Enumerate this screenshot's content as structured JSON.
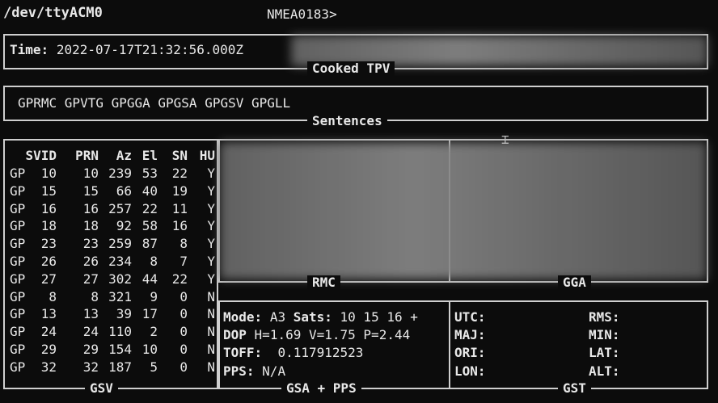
{
  "header": {
    "device": "/dev/ttyACM0",
    "mode": "NMEA0183>"
  },
  "tpv": {
    "time_label": "Time:",
    "time_value": "2022-07-17T21:32:56.000Z",
    "title": "Cooked TPV"
  },
  "sentences": {
    "list": "GPRMC GPVTG GPGGA GPGSA GPGSV GPGLL",
    "title": "Sentences"
  },
  "gsv": {
    "title": "GSV",
    "columns": [
      "SVID",
      "PRN",
      "Az",
      "El",
      "SN",
      "HU"
    ],
    "rows": [
      {
        "gnss": "GP",
        "svid": "10",
        "prn": "10",
        "az": "239",
        "el": "53",
        "sn": "22",
        "hu": "Y"
      },
      {
        "gnss": "GP",
        "svid": "15",
        "prn": "15",
        "az": "66",
        "el": "40",
        "sn": "19",
        "hu": "Y"
      },
      {
        "gnss": "GP",
        "svid": "16",
        "prn": "16",
        "az": "257",
        "el": "22",
        "sn": "11",
        "hu": "Y"
      },
      {
        "gnss": "GP",
        "svid": "18",
        "prn": "18",
        "az": "92",
        "el": "58",
        "sn": "16",
        "hu": "Y"
      },
      {
        "gnss": "GP",
        "svid": "23",
        "prn": "23",
        "az": "259",
        "el": "87",
        "sn": "8",
        "hu": "Y"
      },
      {
        "gnss": "GP",
        "svid": "26",
        "prn": "26",
        "az": "234",
        "el": "8",
        "sn": "7",
        "hu": "Y"
      },
      {
        "gnss": "GP",
        "svid": "27",
        "prn": "27",
        "az": "302",
        "el": "44",
        "sn": "22",
        "hu": "Y"
      },
      {
        "gnss": "GP",
        "svid": "8",
        "prn": "8",
        "az": "321",
        "el": "9",
        "sn": "0",
        "hu": "N"
      },
      {
        "gnss": "GP",
        "svid": "13",
        "prn": "13",
        "az": "39",
        "el": "17",
        "sn": "0",
        "hu": "N"
      },
      {
        "gnss": "GP",
        "svid": "24",
        "prn": "24",
        "az": "110",
        "el": "2",
        "sn": "0",
        "hu": "N"
      },
      {
        "gnss": "GP",
        "svid": "29",
        "prn": "29",
        "az": "154",
        "el": "10",
        "sn": "0",
        "hu": "N"
      },
      {
        "gnss": "GP",
        "svid": "32",
        "prn": "32",
        "az": "187",
        "el": "5",
        "sn": "0",
        "hu": "N"
      }
    ]
  },
  "rmc": {
    "title": "RMC"
  },
  "gga": {
    "title": "GGA"
  },
  "gsa": {
    "title": "GSA + PPS",
    "mode_label": "Mode:",
    "mode_value": "A3",
    "sats_label": "Sats:",
    "sats_value": "10 15 16 +",
    "dop_label": "DOP",
    "dop_h": "H=1.69",
    "dop_v": "V=1.75",
    "dop_p": "P=2.44",
    "toff_label": "TOFF:",
    "toff_value": "0.117912523",
    "pps_label": "PPS:",
    "pps_value": "N/A"
  },
  "gst": {
    "title": "GST",
    "utc_label": "UTC:",
    "rms_label": "RMS:",
    "maj_label": "MAJ:",
    "min_label": "MIN:",
    "ori_label": "ORI:",
    "lat_label": "LAT:",
    "lon_label": "LON:",
    "alt_label": "ALT:"
  }
}
